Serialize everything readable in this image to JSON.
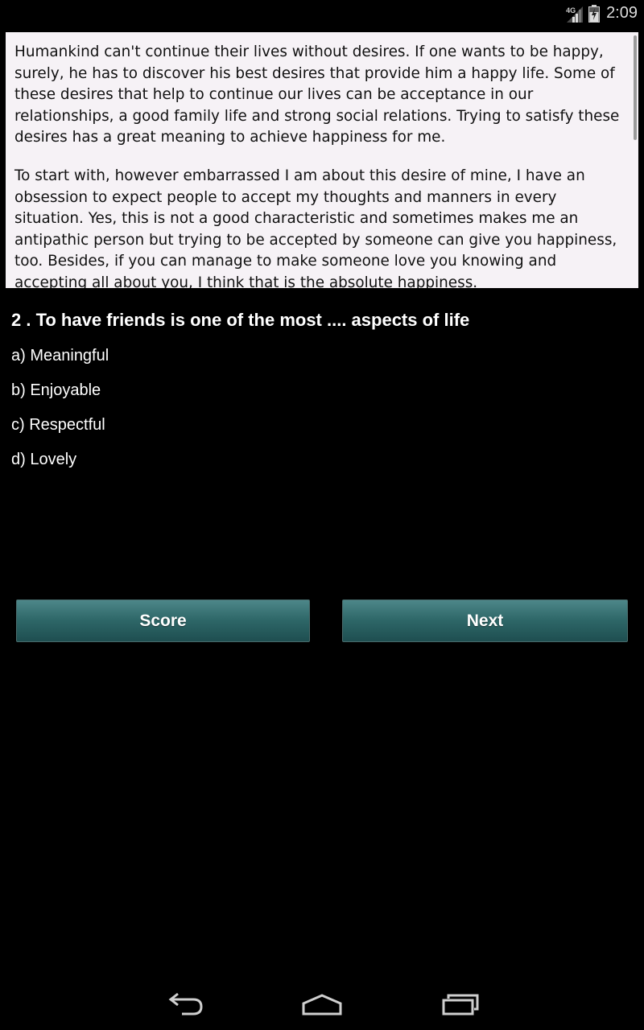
{
  "status_bar": {
    "network": "4G",
    "time": "2:09",
    "icons": [
      "signal-icon",
      "battery-icon"
    ]
  },
  "passage": {
    "paragraphs": [
      "Humankind can't continue their lives without desires. If one wants to be happy, surely, he has to discover his best desires that provide him a happy life. Some of these desires that help to continue our lives can be acceptance in our relationships, a good family life and strong social relations. Trying to satisfy these desires has a great meaning to achieve happiness for me.",
      "To start with, however embarrassed I am about this desire of mine, I have an obsession to expect people to accept my thoughts and manners in every situation. Yes, this is not a good characteristic and sometimes makes me an antipathic person but trying to be accepted by someone can give you happiness, too. Besides, if you can manage to make someone love you knowing and accepting all about you, I think that is the absolute happiness."
    ]
  },
  "question": {
    "text": "2 . To have friends is one of the most .... aspects of life",
    "options": [
      "a) Meaningful",
      "b) Enjoyable",
      "c) Respectful",
      "d) Lovely"
    ]
  },
  "buttons": {
    "score_label": "Score",
    "next_label": "Next"
  },
  "nav_bar": {
    "icons": [
      "back-icon",
      "home-icon",
      "recent-apps-icon"
    ]
  }
}
